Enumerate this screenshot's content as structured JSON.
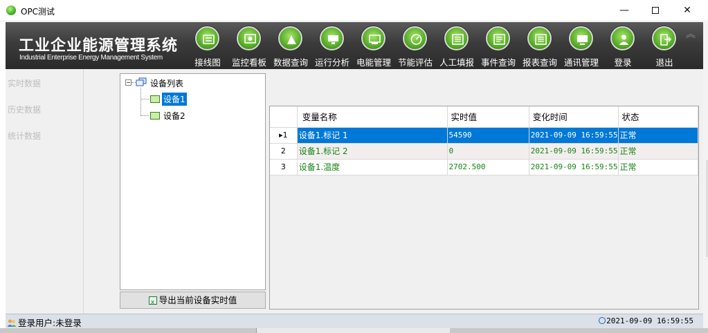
{
  "window": {
    "title": "OPC测试",
    "minimize_glyph": "—",
    "close_glyph": "✕"
  },
  "header": {
    "app_name": "工业企业能源管理系统",
    "app_subname": "Industrial Enterprise Energy Management System",
    "collapse_glyph": "︽",
    "nav": [
      {
        "label": "接线图",
        "icon": "wiring-diagram-icon"
      },
      {
        "label": "监控看板",
        "icon": "monitor-board-icon"
      },
      {
        "label": "数据查询",
        "icon": "data-query-icon"
      },
      {
        "label": "运行分析",
        "icon": "run-analysis-icon"
      },
      {
        "label": "电能管理",
        "icon": "energy-management-icon"
      },
      {
        "label": "节能评估",
        "icon": "energy-saving-icon"
      },
      {
        "label": "人工填报",
        "icon": "manual-entry-icon"
      },
      {
        "label": "事件查询",
        "icon": "event-query-icon"
      },
      {
        "label": "报表查询",
        "icon": "report-query-icon"
      },
      {
        "label": "通讯管理",
        "icon": "communication-icon"
      },
      {
        "label": "登录",
        "icon": "login-icon"
      },
      {
        "label": "退出",
        "icon": "exit-icon"
      }
    ],
    "nav_color": "#5cb12c"
  },
  "leftmenu": {
    "items": [
      "实时数据",
      "历史数据",
      "统计数据"
    ]
  },
  "tree": {
    "root_label": "设备列表",
    "toggle": "−",
    "devices": [
      {
        "label": "设备1",
        "selected": true
      },
      {
        "label": "设备2",
        "selected": false
      }
    ]
  },
  "export_button": {
    "label": "导出当前设备实时值"
  },
  "grid": {
    "columns": [
      "变量名称",
      "实时值",
      "变化时间",
      "状态"
    ],
    "rows": [
      {
        "index": "▸1",
        "name": "设备1.标记 1",
        "value": "54590",
        "time": "2021-09-09 16:59:55",
        "status": "正常"
      },
      {
        "index": "2",
        "name": "设备1.标记 2",
        "value": "0",
        "time": "2021-09-09 16:59:55",
        "status": "正常"
      },
      {
        "index": "3",
        "name": "设备1.温度",
        "value": "2702.500",
        "time": "2021-09-09 16:59:55",
        "status": "正常"
      }
    ],
    "selected_color": "#0078d7",
    "value_color": "#148214"
  },
  "statusbar": {
    "user": "登录用户:未登录",
    "time": "2021-09-09 16:59:55"
  }
}
